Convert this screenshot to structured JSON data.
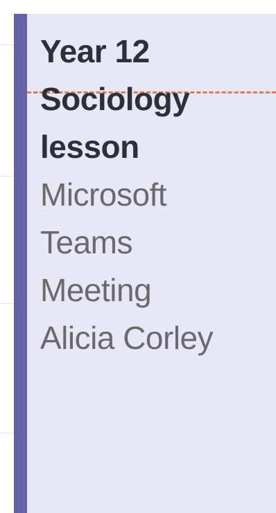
{
  "event": {
    "title_line_1": "Year 12",
    "title_line_2": "Sociology",
    "title_line_3": "lesson",
    "location_line_1": "Microsoft",
    "location_line_2": "Teams",
    "location_line_3": "Meeting",
    "organizer": "Alicia Corley"
  },
  "colors": {
    "accent": "#6264a7",
    "card_background": "#e7e7f6",
    "time_indicator": "#e07a4a"
  }
}
